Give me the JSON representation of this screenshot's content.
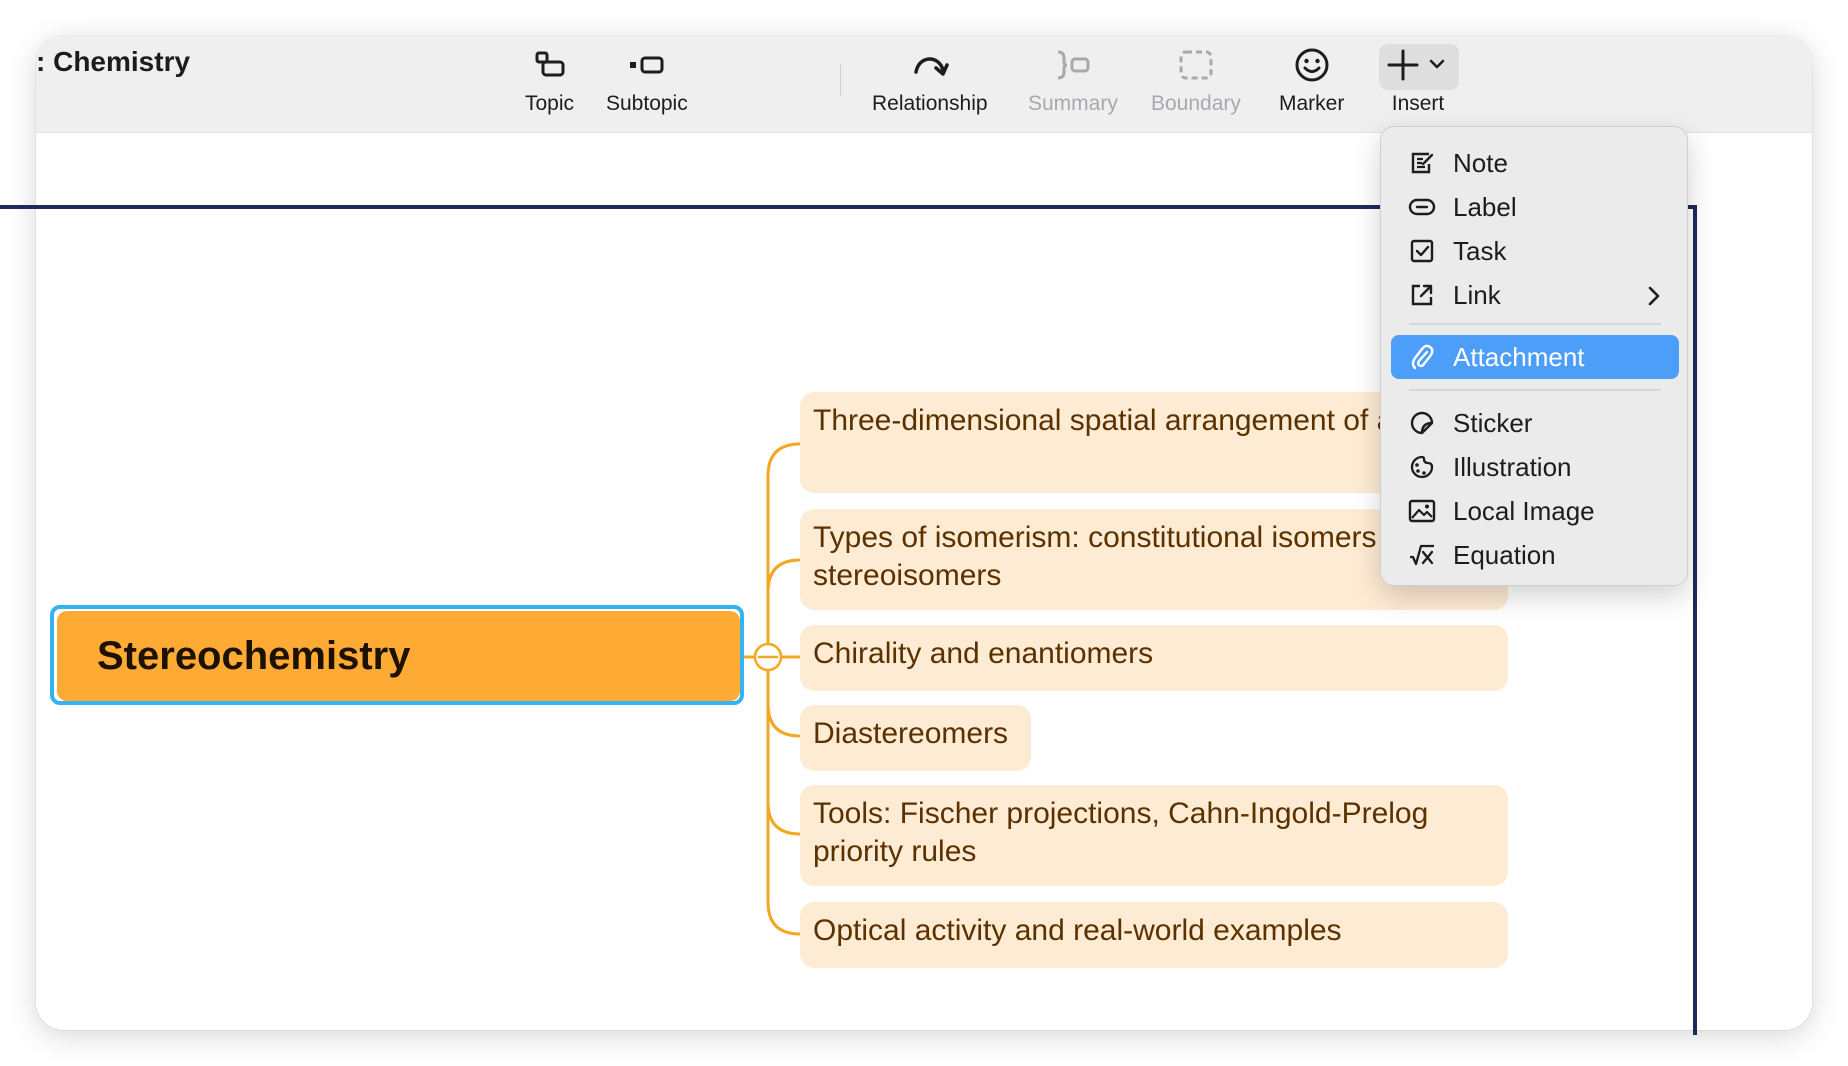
{
  "window": {
    "title": ": Chemistry"
  },
  "toolbar": {
    "topic": {
      "label": "Topic",
      "icon": "topic-icon"
    },
    "subtopic": {
      "label": "Subtopic",
      "icon": "subtopic-icon"
    },
    "relationship": {
      "label": "Relationship",
      "icon": "relationship-arrow-icon"
    },
    "summary": {
      "label": "Summary",
      "icon": "summary-brace-icon",
      "disabled": true
    },
    "boundary": {
      "label": "Boundary",
      "icon": "boundary-icon",
      "disabled": true
    },
    "marker": {
      "label": "Marker",
      "icon": "smiley-icon"
    },
    "insert": {
      "label": "Insert",
      "icon": "plus-icon"
    }
  },
  "mindmap": {
    "root": "Stereochemistry",
    "topics": [
      "Three-dimensional spatial arrangement of atoms",
      "Types of isomerism: constitutional isomers vs stereoisomers",
      "Chirality and enantiomers",
      "Diastereomers",
      "Tools: Fischer projections, Cahn-Ingold-Prelog priority rules",
      "Optical activity and real-world examples"
    ]
  },
  "insert_menu": {
    "items": [
      {
        "label": "Note",
        "icon": "note-icon"
      },
      {
        "label": "Label",
        "icon": "label-icon"
      },
      {
        "label": "Task",
        "icon": "task-checkbox-icon"
      },
      {
        "label": "Link",
        "icon": "link-icon",
        "submenu": true
      },
      {
        "label": "Attachment",
        "icon": "paperclip-icon",
        "highlighted": true
      },
      {
        "label": "Sticker",
        "icon": "sticker-icon"
      },
      {
        "label": "Illustration",
        "icon": "illustration-icon"
      },
      {
        "label": "Local Image",
        "icon": "image-icon"
      },
      {
        "label": "Equation",
        "icon": "equation-icon"
      }
    ]
  },
  "colors": {
    "root_fill": "#fdab35",
    "root_selection": "#33b3ef",
    "topic_fill": "#fdebd3",
    "branch_line": "#f5a623",
    "frame": "#1f2a5c",
    "menu_highlight": "#4c9ef8"
  }
}
